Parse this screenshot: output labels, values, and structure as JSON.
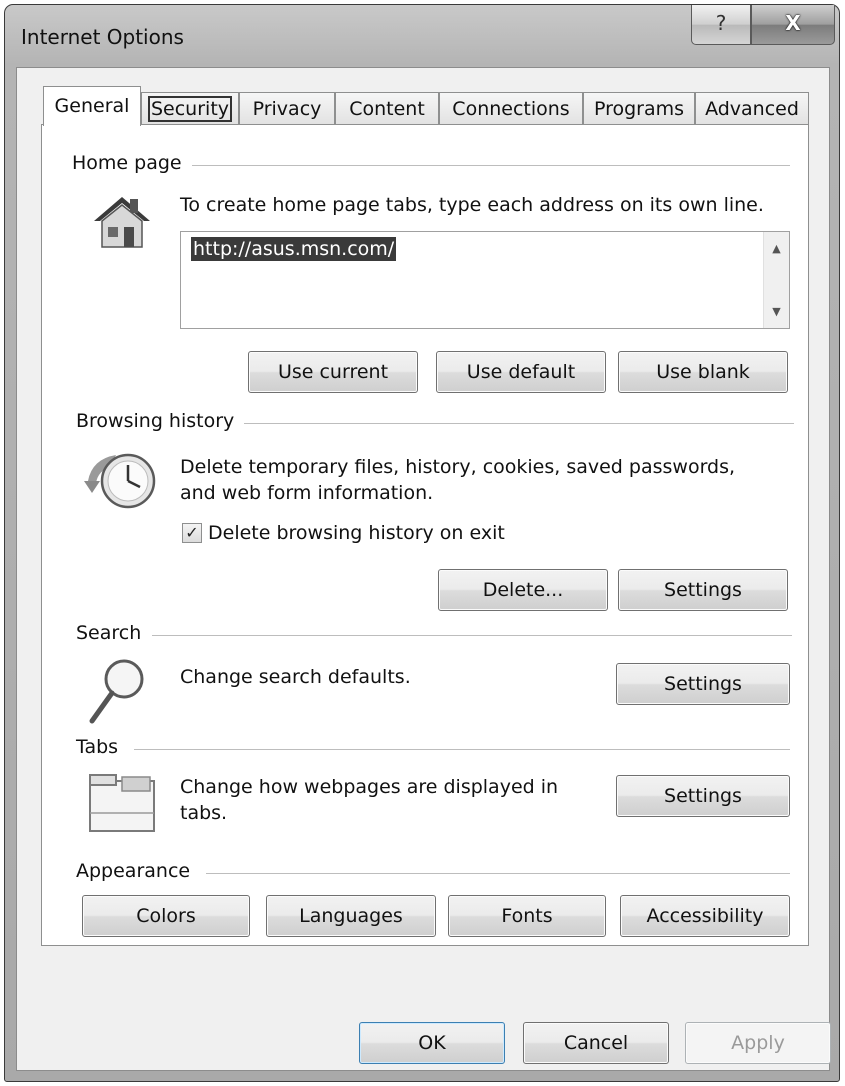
{
  "window": {
    "title": "Internet Options",
    "help_glyph": "?",
    "close_glyph": "X"
  },
  "tabs": [
    {
      "label": "General",
      "active": true
    },
    {
      "label": "Security",
      "focused": true
    },
    {
      "label": "Privacy"
    },
    {
      "label": "Content"
    },
    {
      "label": "Connections"
    },
    {
      "label": "Programs"
    },
    {
      "label": "Advanced"
    }
  ],
  "home_page": {
    "section_label": "Home page",
    "icon": "house-icon",
    "description": "To create home page tabs, type each address on its own line.",
    "address_value": "http://asus.msn.com/",
    "buttons": {
      "use_current": "Use current",
      "use_default": "Use default",
      "use_blank": "Use blank"
    }
  },
  "browsing_history": {
    "section_label": "Browsing history",
    "icon": "history-clock-icon",
    "description_line1": "Delete temporary files, history, cookies, saved passwords,",
    "description_line2": "and web form information.",
    "checkbox_label": "Delete browsing history on exit",
    "checkbox_checked": true,
    "buttons": {
      "delete": "Delete...",
      "settings": "Settings"
    }
  },
  "search": {
    "section_label": "Search",
    "icon": "magnifier-icon",
    "description": "Change search defaults.",
    "settings_label": "Settings"
  },
  "tabs_section": {
    "section_label": "Tabs",
    "icon": "tabs-window-icon",
    "description_line1": "Change how webpages are displayed in",
    "description_line2": "tabs.",
    "settings_label": "Settings"
  },
  "appearance": {
    "section_label": "Appearance",
    "buttons": {
      "colors": "Colors",
      "languages": "Languages",
      "fonts": "Fonts",
      "accessibility": "Accessibility"
    }
  },
  "footer": {
    "ok": "OK",
    "cancel": "Cancel",
    "apply": "Apply",
    "apply_enabled": false
  }
}
